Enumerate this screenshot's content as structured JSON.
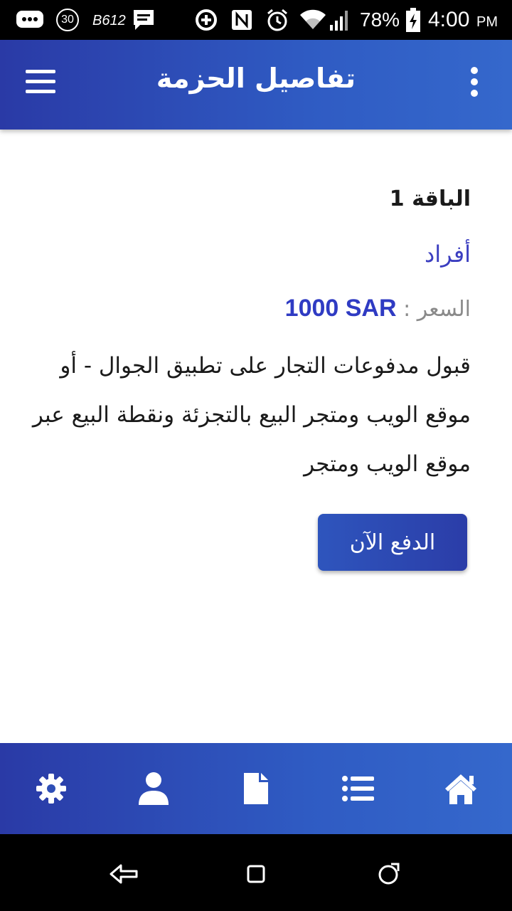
{
  "status_bar": {
    "notif_30": "30",
    "carrier_tag": "B612",
    "battery_percent": "78%",
    "time": "4:00",
    "ampm": "PM"
  },
  "app_bar": {
    "title": "تفاصيل الحزمة",
    "menu_icon": "hamburger-icon",
    "more_icon": "more-vert-icon"
  },
  "package": {
    "title": "الباقة 1",
    "type": "أفراد",
    "price_label": "السعر",
    "price_separator": " : ",
    "price_value": "1000 SAR",
    "description": "قبول مدفوعات التجار على تطبيق الجوال - أو موقع الويب ومتجر البيع بالتجزئة ونقطة البيع عبر موقع الويب ومتجر",
    "pay_button": "الدفع الآن"
  },
  "bottom_nav": {
    "items": [
      "settings-icon",
      "profile-icon",
      "document-icon",
      "list-icon",
      "home-icon"
    ]
  },
  "colors": {
    "primary_start": "#2a3aa6",
    "primary_end": "#3568cc",
    "accent_text": "#2f3bc3",
    "type_text": "#3b3ec0"
  }
}
